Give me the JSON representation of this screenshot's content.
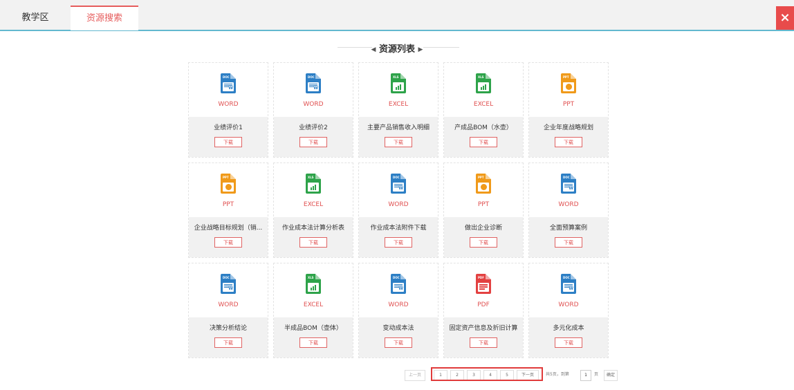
{
  "tabs": [
    {
      "label": "教学区"
    },
    {
      "label": "资源搜索"
    }
  ],
  "close": {
    "icon": "close-icon",
    "symbol": "×"
  },
  "section": {
    "title": "资源列表"
  },
  "colors": {
    "word": "#2d7fc5",
    "excel": "#2ea34a",
    "ppt": "#f09a1a",
    "pdf": "#e34141",
    "accent": "#e05050",
    "tab_underline": "#62b8cf"
  },
  "download_label": "下载",
  "files": [
    {
      "type": "WORD",
      "name": "业绩评价1",
      "kind": "word",
      "tag": "DOC"
    },
    {
      "type": "WORD",
      "name": "业绩评价2",
      "kind": "word",
      "tag": "DOC"
    },
    {
      "type": "EXCEL",
      "name": "主要产品销售收入明细",
      "kind": "excel",
      "tag": "XLS"
    },
    {
      "type": "EXCEL",
      "name": "产成品BOM（水壶）",
      "kind": "excel",
      "tag": "XLS"
    },
    {
      "type": "PPT",
      "name": "企业年度战略规划",
      "kind": "ppt",
      "tag": "PPT"
    },
    {
      "type": "PPT",
      "name": "企业战略目标规划（销...",
      "kind": "ppt",
      "tag": "PPT"
    },
    {
      "type": "EXCEL",
      "name": "作业成本法计算分析表",
      "kind": "excel",
      "tag": "XLS"
    },
    {
      "type": "WORD",
      "name": "作业成本法附件下载",
      "kind": "word",
      "tag": "DOC"
    },
    {
      "type": "PPT",
      "name": "做出企业诊断",
      "kind": "ppt",
      "tag": "PPT"
    },
    {
      "type": "WORD",
      "name": "全面预算案例",
      "kind": "word",
      "tag": "DOC"
    },
    {
      "type": "WORD",
      "name": "决策分析结论",
      "kind": "word",
      "tag": "DOC"
    },
    {
      "type": "EXCEL",
      "name": "半成品BOM（壶体）",
      "kind": "excel",
      "tag": "XLS"
    },
    {
      "type": "WORD",
      "name": "变动成本法",
      "kind": "word",
      "tag": "DOC"
    },
    {
      "type": "PDF",
      "name": "固定资产信息及折旧计算",
      "kind": "pdf",
      "tag": "PDF"
    },
    {
      "type": "WORD",
      "name": "多元化成本",
      "kind": "word",
      "tag": "DOC"
    }
  ],
  "pagination": {
    "prev": "上一页",
    "pages": [
      "1",
      "2",
      "3",
      "4",
      "5"
    ],
    "next": "下一页",
    "total_text": "共5页，到第",
    "page_input": "1",
    "page_unit": "页",
    "confirm": "确定"
  }
}
